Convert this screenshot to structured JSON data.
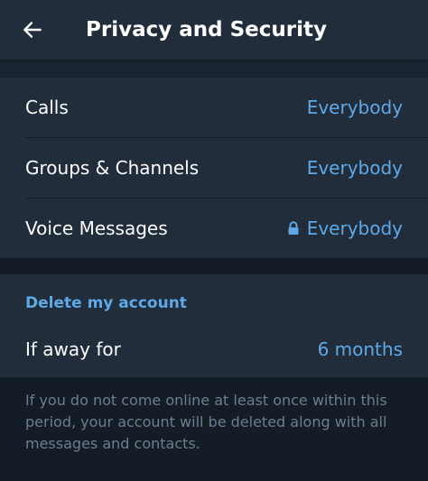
{
  "header": {
    "back_icon": "arrow-left-icon",
    "title": "Privacy and Security"
  },
  "privacy": {
    "items": [
      {
        "label": "Calls",
        "value": "Everybody",
        "locked": false
      },
      {
        "label": "Groups & Channels",
        "value": "Everybody",
        "locked": false
      },
      {
        "label": "Voice Messages",
        "value": "Everybody",
        "locked": true,
        "icon": "lock-icon"
      }
    ]
  },
  "delete_account": {
    "section_title": "Delete my account",
    "row_label": "If away for",
    "row_value": "6 months",
    "info": "If you do not come online at least once within this period, your account will be deleted along with all messages and contacts."
  },
  "colors": {
    "accent": "#5fa8e6",
    "background": "#141c26",
    "card": "#212d3b",
    "muted_text": "#6d7d8f"
  }
}
